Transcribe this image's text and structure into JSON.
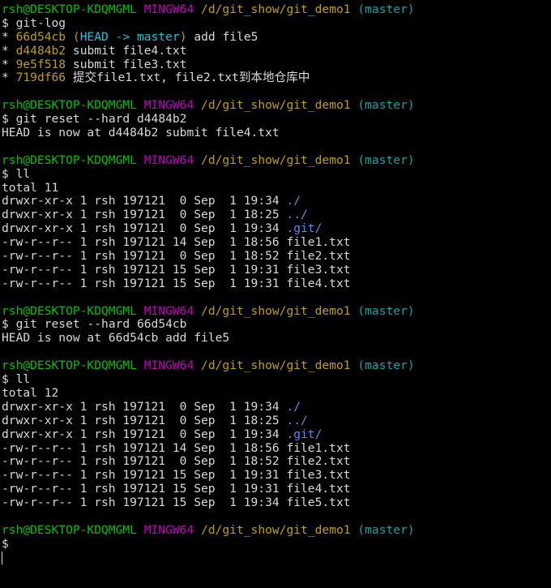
{
  "prompt": {
    "user": "rsh@DESKTOP-KDQMGML",
    "env": "MINGW64",
    "path": "/d/git_show/git_demo1",
    "branch": "(master)",
    "symbol": "$"
  },
  "colors": {
    "background": "#000000",
    "text": "#d8d8d8",
    "user_green": "#00c000",
    "env_magenta": "#c000c0",
    "path_yellow": "#c0a000",
    "branch_cyan": "#00a8a8",
    "head_cyan": "#10c8d8",
    "dir_blue": "#5c8cf0"
  },
  "blocks": [
    {
      "command": "git-log",
      "log": [
        {
          "star": "*",
          "hash": "66d54cb",
          "refs": {
            "open": "(",
            "head": "HEAD -> master",
            "close": ")"
          },
          "message": "add file5"
        },
        {
          "star": "*",
          "hash": "d4484b2",
          "message": "submit file4.txt"
        },
        {
          "star": "*",
          "hash": "9e5f518",
          "message": "submit file3.txt"
        },
        {
          "star": "*",
          "hash": "719df66",
          "message": "提交file1.txt, file2.txt到本地仓库中"
        }
      ]
    },
    {
      "command": "git reset --hard d4484b2",
      "output": [
        "HEAD is now at d4484b2 submit file4.txt"
      ]
    },
    {
      "command": "ll",
      "total": "total 11",
      "listing": [
        {
          "meta": "drwxr-xr-x 1 rsh 197121  0 Sep  1 19:34 ",
          "name": "./",
          "dir": true
        },
        {
          "meta": "drwxr-xr-x 1 rsh 197121  0 Sep  1 18:25 ",
          "name": "../",
          "dir": true
        },
        {
          "meta": "drwxr-xr-x 1 rsh 197121  0 Sep  1 19:34 ",
          "name": ".git/",
          "dir": true
        },
        {
          "meta": "-rw-r--r-- 1 rsh 197121 14 Sep  1 18:56 ",
          "name": "file1.txt",
          "dir": false
        },
        {
          "meta": "-rw-r--r-- 1 rsh 197121  0 Sep  1 18:52 ",
          "name": "file2.txt",
          "dir": false
        },
        {
          "meta": "-rw-r--r-- 1 rsh 197121 15 Sep  1 19:31 ",
          "name": "file3.txt",
          "dir": false
        },
        {
          "meta": "-rw-r--r-- 1 rsh 197121 15 Sep  1 19:31 ",
          "name": "file4.txt",
          "dir": false
        }
      ]
    },
    {
      "command": "git reset --hard 66d54cb",
      "output": [
        "HEAD is now at 66d54cb add file5"
      ]
    },
    {
      "command": "ll",
      "total": "total 12",
      "listing": [
        {
          "meta": "drwxr-xr-x 1 rsh 197121  0 Sep  1 19:34 ",
          "name": "./",
          "dir": true
        },
        {
          "meta": "drwxr-xr-x 1 rsh 197121  0 Sep  1 18:25 ",
          "name": "../",
          "dir": true
        },
        {
          "meta": "drwxr-xr-x 1 rsh 197121  0 Sep  1 19:34 ",
          "name": ".git/",
          "dir": true
        },
        {
          "meta": "-rw-r--r-- 1 rsh 197121 14 Sep  1 18:56 ",
          "name": "file1.txt",
          "dir": false
        },
        {
          "meta": "-rw-r--r-- 1 rsh 197121  0 Sep  1 18:52 ",
          "name": "file2.txt",
          "dir": false
        },
        {
          "meta": "-rw-r--r-- 1 rsh 197121 15 Sep  1 19:31 ",
          "name": "file3.txt",
          "dir": false
        },
        {
          "meta": "-rw-r--r-- 1 rsh 197121 15 Sep  1 19:31 ",
          "name": "file4.txt",
          "dir": false
        },
        {
          "meta": "-rw-r--r-- 1 rsh 197121 15 Sep  1 19:34 ",
          "name": "file5.txt",
          "dir": false
        }
      ]
    },
    {
      "command": ""
    }
  ]
}
